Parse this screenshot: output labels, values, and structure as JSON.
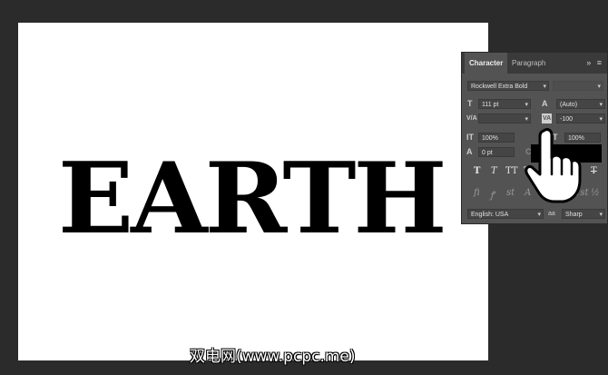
{
  "canvas": {
    "text": "EARTH"
  },
  "panel": {
    "tabs": [
      {
        "label": "Character",
        "active": true
      },
      {
        "label": "Paragraph",
        "active": false
      }
    ],
    "menu_icons": "»  ≡",
    "font_family": "Rockwell Extra Bold",
    "font_size": "111 pt",
    "leading": "(Auto)",
    "kerning": "",
    "tracking": "-100",
    "vertical_scale": "100%",
    "horizontal_scale": "100%",
    "baseline_shift": "0 pt",
    "color_label": "C",
    "style_buttons": [
      "T",
      "T",
      "TT",
      "Tт",
      "T¹",
      "T₁",
      "T",
      "T"
    ],
    "opentype_buttons": [
      "fi",
      "ꝭ",
      "st",
      "A",
      "ad",
      "T",
      "1st",
      "½"
    ],
    "language": "English: USA",
    "antialias_icon": "aa",
    "antialias": "Sharp"
  },
  "watermark": "双电网(www.pcpc.me)",
  "colors": {
    "panel_bg": "#535353",
    "tabbar_bg": "#3a3a3a",
    "workspace_bg": "#2b2b2b",
    "text_color": "#000000"
  }
}
